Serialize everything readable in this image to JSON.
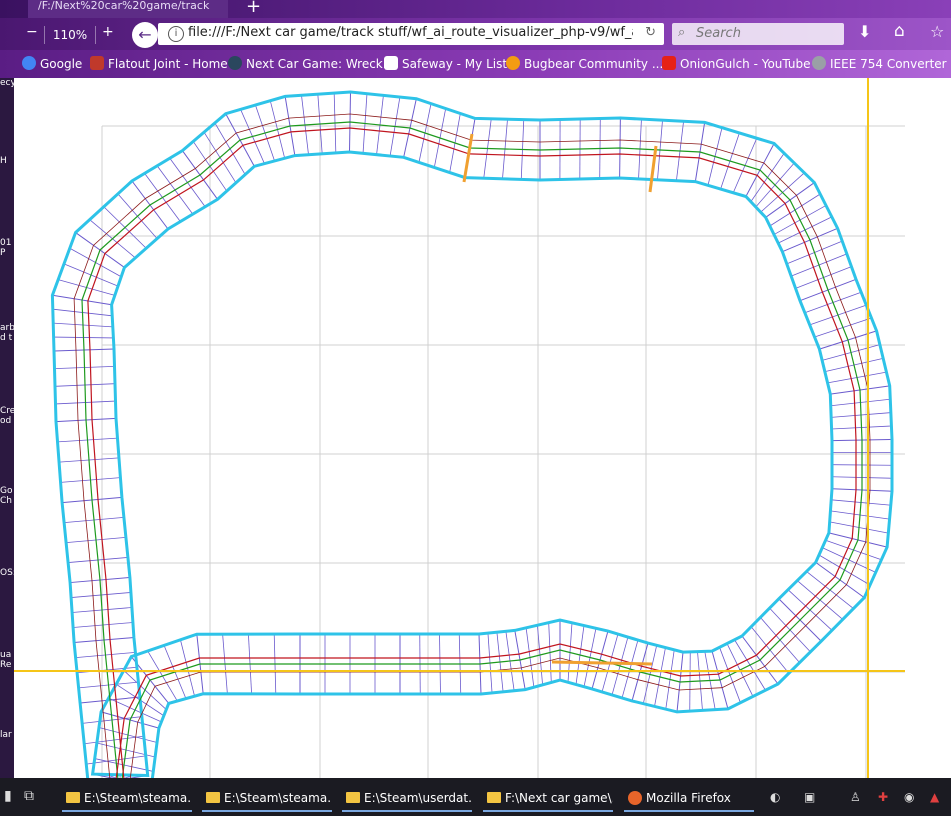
{
  "browser": {
    "tab_title": "/F:/Next%20car%20game/track",
    "zoom": "110%",
    "url": "file:///F:/Next car game/track stuff/wf_ai_route_visualizer_php-v9/wf_a",
    "search_placeholder": "Search"
  },
  "bookmarks": [
    {
      "label": "Google",
      "icon": "google-icon",
      "color": "#4285f4"
    },
    {
      "label": "Flatout Joint - Home",
      "icon": "flatout-icon",
      "color": "#c0392b"
    },
    {
      "label": "Next Car Game: Wreck...",
      "icon": "steam-icon",
      "color": "#2a475e"
    },
    {
      "label": "Safeway - My List",
      "icon": "page-icon",
      "color": "#ffffff"
    },
    {
      "label": "Bugbear Community ...",
      "icon": "bugbear-icon",
      "color": "#f39c12"
    },
    {
      "label": "OnionGulch - YouTube",
      "icon": "youtube-icon",
      "color": "#e62117"
    },
    {
      "label": "IEEE 754 Converter",
      "icon": "globe-icon",
      "color": "#9aa0a6"
    }
  ],
  "track": {
    "outer_border_color": "#2ec3e8",
    "racing_line_color": "#c0151f",
    "center_line_color": "#1e9a1e",
    "divider_color": "#6a5acd",
    "marker_color": "#f0a030",
    "grid_color": "#d0d0d0"
  },
  "desktop_labels": [
    "ecy",
    "H",
    "01 P",
    "arb d t",
    "Cre od",
    "Go Ch",
    "OS:",
    "ua Re",
    "lar"
  ],
  "taskbar": {
    "tasks": [
      {
        "label": "E:\\Steam\\steama...",
        "type": "folder"
      },
      {
        "label": "E:\\Steam\\steama...",
        "type": "folder"
      },
      {
        "label": "E:\\Steam\\userdat...",
        "type": "folder"
      },
      {
        "label": "F:\\Next car game\\...",
        "type": "folder"
      },
      {
        "label": "Mozilla Firefox",
        "type": "firefox"
      }
    ]
  }
}
